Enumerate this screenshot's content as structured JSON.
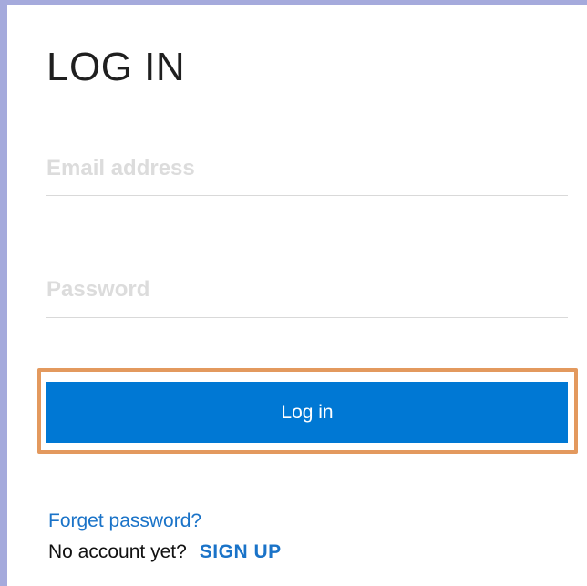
{
  "login": {
    "title": "LOG IN",
    "email_placeholder": "Email address",
    "email_value": "",
    "password_placeholder": "Password",
    "password_value": "",
    "button_label": "Log in",
    "forget_password": "Forget password?",
    "no_account_text": "No account yet?",
    "signup_label": "SIGN UP"
  },
  "colors": {
    "primary": "#0078d4",
    "link": "#1a73c8",
    "focus_ring": "#e3995e",
    "frame_border": "#a5aadc",
    "placeholder": "#dcdcdc"
  }
}
